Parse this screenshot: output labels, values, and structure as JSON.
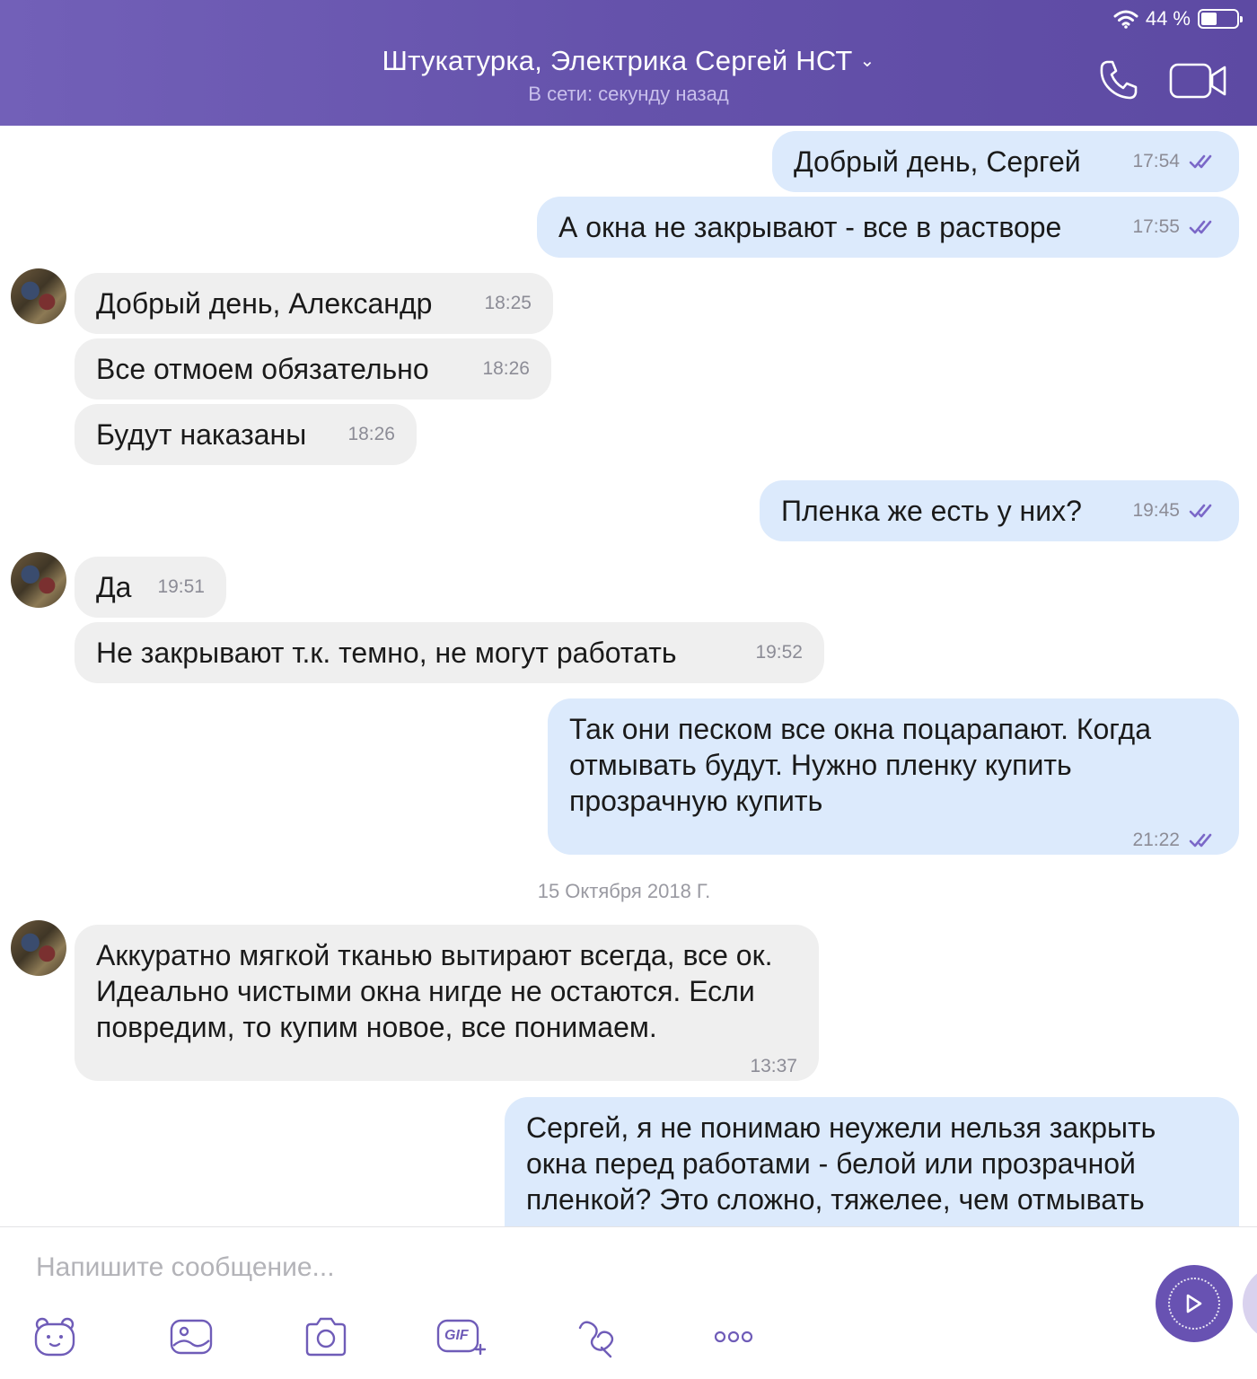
{
  "status_bar": {
    "battery_text": "44 %",
    "battery_level": 0.44
  },
  "header": {
    "title": "Штукатурка, Электрика Сергей НСТ",
    "chevron": "⌄",
    "subtitle": "В сети: секунду назад"
  },
  "messages": [
    {
      "direction": "out",
      "text": "Добрый день, Сергей",
      "time": "17:54",
      "read": true
    },
    {
      "direction": "out",
      "text": "А окна не закрывают - все в растворе",
      "time": "17:55",
      "read": true
    },
    {
      "direction": "in",
      "text": "Добрый день, Александр",
      "time": "18:25"
    },
    {
      "direction": "in",
      "text": "Все отмоем обязательно",
      "time": "18:26"
    },
    {
      "direction": "in",
      "text": "Будут наказаны",
      "time": "18:26"
    },
    {
      "direction": "out",
      "text": "Пленка же есть у них?",
      "time": "19:45",
      "read": true
    },
    {
      "direction": "in",
      "text": "Да",
      "time": "19:51"
    },
    {
      "direction": "in",
      "text": "Не закрывают т.к. темно, не могут работать",
      "time": "19:52"
    },
    {
      "direction": "out",
      "text": "Так они песком все окна поцарапают. Когда отмывать будут. Нужно пленку купить прозрачную купить",
      "time": "21:22",
      "read": true
    },
    {
      "direction": "in",
      "text": "Аккуратно мягкой тканью вытирают всегда, все ок. Идеально чистыми окна нигде не остаются. Если повредим, то купим новое, все понимаем.",
      "time": "13:37"
    },
    {
      "direction": "out",
      "text": "Сергей, я не понимаю неужели нельзя закрыть окна перед работами - белой или прозрачной пленкой? Это сложно, тяжелее, чем отмывать",
      "time": ""
    }
  ],
  "date_separator": "15 Октября 2018 Г.",
  "composer": {
    "placeholder": "Напишите сообщение...",
    "tools": [
      "sticker-icon",
      "gallery-icon",
      "camera-icon",
      "gif-icon",
      "doodle-icon",
      "more-icon"
    ],
    "gif_label": "GIF"
  },
  "colors": {
    "header_bg": "#6552ab",
    "outgoing_bubble": "#dceafc",
    "incoming_bubble": "#efefef",
    "read_tick": "#7b68c8",
    "send_button": "#6852b2"
  }
}
